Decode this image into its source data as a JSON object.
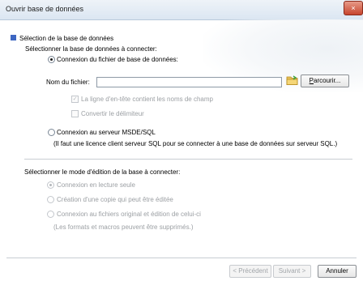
{
  "window": {
    "title": "Ouvrir base de données",
    "close_glyph": "×"
  },
  "section": {
    "heading": "Sélection de la base de données",
    "connect_prompt": "Sélectionner la base de données à connecter:"
  },
  "file_option": {
    "label": "Connexion du fichier de base de données:",
    "checked": true
  },
  "file_name": {
    "label": "Nom du fichier:",
    "value": ""
  },
  "browse": {
    "label_first": "P",
    "label_rest": "arcourir..."
  },
  "header_row": {
    "label": "La ligne d'en-tête contient les noms de champ",
    "checked": true,
    "check_glyph": "✓"
  },
  "delimiter": {
    "label": "Convertir le délimiteur",
    "checked": false
  },
  "server_option": {
    "label": "Connexion au serveur MSDE/SQL",
    "note": "(Il faut une licence client serveur SQL pour se connecter à une base de données sur serveur SQL.)"
  },
  "edit_mode": {
    "heading": "Sélectionner le mode d'édition de la base à connecter:",
    "options": [
      "Connexion en lecture seule",
      "Création d'une copie qui peut être éditée",
      "Connexion au fichiers original et édition de celui-ci"
    ],
    "note": "(Les formats et macros peuvent être supprimés.)"
  },
  "footer": {
    "previous": "< Précédent",
    "next": "Suivant >",
    "cancel": "Annuler"
  },
  "colors": {
    "accent": "#3e67c2",
    "close_red": "#c7452e",
    "disabled_text": "#9b9fa3"
  },
  "icons": {
    "folder": "folder-icon",
    "close": "close-icon"
  }
}
